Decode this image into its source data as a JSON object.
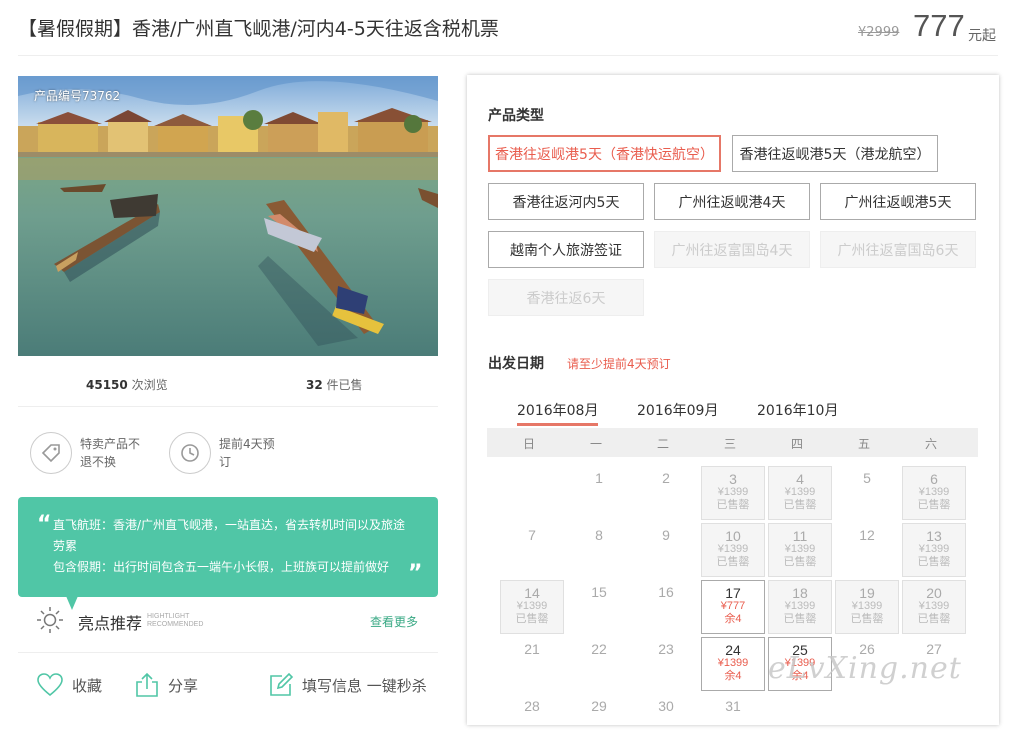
{
  "header": {
    "title": "【暑假假期】香港/广州直飞岘港/河内4-5天往返含税机票",
    "original_price": "¥2999",
    "price": "777",
    "price_suffix": "元起"
  },
  "product": {
    "code_label": "产品编号73762",
    "views_count": "45150",
    "views_label": "次浏览",
    "sold_count": "32",
    "sold_label": "件已售"
  },
  "features": [
    {
      "icon": "tag-icon",
      "text": "特卖产品不退不换"
    },
    {
      "icon": "clock-history-icon",
      "text": "提前4天预订"
    }
  ],
  "highlight": {
    "lines": [
      "直飞航班：香港/广州直飞岘港，一站直达，省去转机时间以及旅途劳累",
      "包含假期：出行时间包含五一端午小长假，上班族可以提前做好"
    ],
    "title": "亮点推荐",
    "title_en_1": "HIGHTLIGHT",
    "title_en_2": "RECOMMENDED",
    "more": "查看更多"
  },
  "actions": {
    "favorite": "收藏",
    "share": "分享",
    "fill_info": "填写信息 一键秒杀"
  },
  "product_types": {
    "title": "产品类型",
    "options": [
      {
        "label": "香港往返岘港5天（香港快运航空）",
        "state": "active"
      },
      {
        "label": "香港往返岘港5天（港龙航空）",
        "state": "normal"
      },
      {
        "label": "香港往返河内5天",
        "state": "normal"
      },
      {
        "label": "广州往返岘港4天",
        "state": "normal"
      },
      {
        "label": "广州往返岘港5天",
        "state": "normal"
      },
      {
        "label": "越南个人旅游签证",
        "state": "normal"
      },
      {
        "label": "广州往返富国岛4天",
        "state": "disabled"
      },
      {
        "label": "广州往返富国岛6天",
        "state": "disabled"
      },
      {
        "label": "香港往返6天",
        "state": "disabled"
      }
    ]
  },
  "departure": {
    "title": "出发日期",
    "hint": "请至少提前4天预订",
    "months": [
      "2016年08月",
      "2016年09月",
      "2016年10月"
    ],
    "active_month": 0,
    "weekdays": [
      "日",
      "一",
      "二",
      "三",
      "四",
      "五",
      "六"
    ],
    "days": [
      {
        "day": "1",
        "col": 1,
        "row": 0
      },
      {
        "day": "2",
        "col": 2,
        "row": 0
      },
      {
        "day": "3",
        "col": 3,
        "row": 0,
        "price": "¥1399",
        "status": "已售罄",
        "state": "soldout"
      },
      {
        "day": "4",
        "col": 4,
        "row": 0,
        "price": "¥1399",
        "status": "已售罄",
        "state": "soldout"
      },
      {
        "day": "5",
        "col": 5,
        "row": 0
      },
      {
        "day": "6",
        "col": 6,
        "row": 0,
        "price": "¥1399",
        "status": "已售罄",
        "state": "soldout"
      },
      {
        "day": "7",
        "col": 0,
        "row": 1
      },
      {
        "day": "8",
        "col": 1,
        "row": 1
      },
      {
        "day": "9",
        "col": 2,
        "row": 1
      },
      {
        "day": "10",
        "col": 3,
        "row": 1,
        "price": "¥1399",
        "status": "已售罄",
        "state": "soldout"
      },
      {
        "day": "11",
        "col": 4,
        "row": 1,
        "price": "¥1399",
        "status": "已售罄",
        "state": "soldout"
      },
      {
        "day": "12",
        "col": 5,
        "row": 1
      },
      {
        "day": "13",
        "col": 6,
        "row": 1,
        "price": "¥1399",
        "status": "已售罄",
        "state": "soldout"
      },
      {
        "day": "14",
        "col": 0,
        "row": 2,
        "price": "¥1399",
        "status": "已售罄",
        "state": "soldout"
      },
      {
        "day": "15",
        "col": 1,
        "row": 2
      },
      {
        "day": "16",
        "col": 2,
        "row": 2
      },
      {
        "day": "17",
        "col": 3,
        "row": 2,
        "price": "¥777",
        "status": "余4",
        "state": "avail"
      },
      {
        "day": "18",
        "col": 4,
        "row": 2,
        "price": "¥1399",
        "status": "已售罄",
        "state": "soldout"
      },
      {
        "day": "19",
        "col": 5,
        "row": 2,
        "price": "¥1399",
        "status": "已售罄",
        "state": "soldout"
      },
      {
        "day": "20",
        "col": 6,
        "row": 2,
        "price": "¥1399",
        "status": "已售罄",
        "state": "soldout"
      },
      {
        "day": "21",
        "col": 0,
        "row": 3
      },
      {
        "day": "22",
        "col": 1,
        "row": 3
      },
      {
        "day": "23",
        "col": 2,
        "row": 3
      },
      {
        "day": "24",
        "col": 3,
        "row": 3,
        "price": "¥1399",
        "status": "余4",
        "state": "avail"
      },
      {
        "day": "25",
        "col": 4,
        "row": 3,
        "price": "¥1399",
        "status": "余4",
        "state": "avail"
      },
      {
        "day": "26",
        "col": 5,
        "row": 3
      },
      {
        "day": "27",
        "col": 6,
        "row": 3
      },
      {
        "day": "28",
        "col": 0,
        "row": 4
      },
      {
        "day": "29",
        "col": 1,
        "row": 4
      },
      {
        "day": "30",
        "col": 2,
        "row": 4
      },
      {
        "day": "31",
        "col": 3,
        "row": 4
      }
    ]
  },
  "watermark": "eLvXing.net",
  "colors": {
    "accent_red": "#e95d4e",
    "accent_green": "#50c6a6",
    "link_green": "#3aa985"
  }
}
